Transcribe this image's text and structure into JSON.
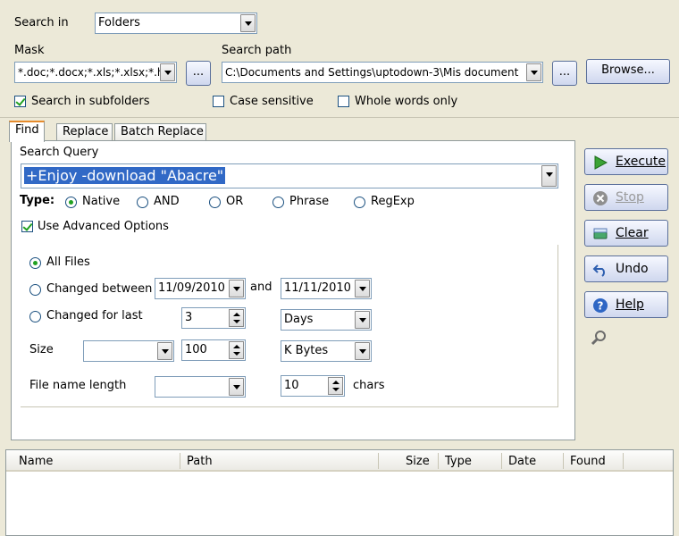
{
  "top": {
    "search_in_label": "Search in",
    "search_in_value": "Folders",
    "mask_label": "Mask",
    "mask_value": "*.doc;*.docx;*.xls;*.xlsx;*.h",
    "search_path_label": "Search path",
    "search_path_value": "C:\\Documents and Settings\\uptodown-3\\Mis document",
    "ellipsis": "...",
    "browse_label": "Browse...",
    "subfolders_label": "Search in subfolders",
    "case_label": "Case sensitive",
    "whole_words_label": "Whole words only"
  },
  "tabs": [
    {
      "label": "Find"
    },
    {
      "label": "Replace"
    },
    {
      "label": "Batch Replace"
    }
  ],
  "find": {
    "query_label": "Search Query",
    "query_value": "+Enjoy -download \"Abacre\"",
    "type_label": "Type:",
    "types": [
      "Native",
      "AND",
      "OR",
      "Phrase",
      "RegExp"
    ],
    "advanced_label": "Use Advanced Options",
    "all_files_label": "All Files",
    "changed_between_label": "Changed between",
    "date_from": "11/09/2010",
    "and_label": "and",
    "date_to": "11/11/2010",
    "changed_last_label": "Changed for last",
    "last_value": "3",
    "last_unit": "Days",
    "size_label": "Size",
    "size_op": "",
    "size_value": "100",
    "size_unit": "K Bytes",
    "name_len_label": "File name length",
    "name_len_op": "",
    "name_len_value": "10",
    "chars_label": "chars"
  },
  "side": {
    "execute": "Execute",
    "stop": "Stop",
    "clear": "Clear",
    "undo": "Undo",
    "help": "Help"
  },
  "results": {
    "columns": [
      "Name",
      "Path",
      "Size",
      "Type",
      "Date",
      "Found"
    ]
  }
}
